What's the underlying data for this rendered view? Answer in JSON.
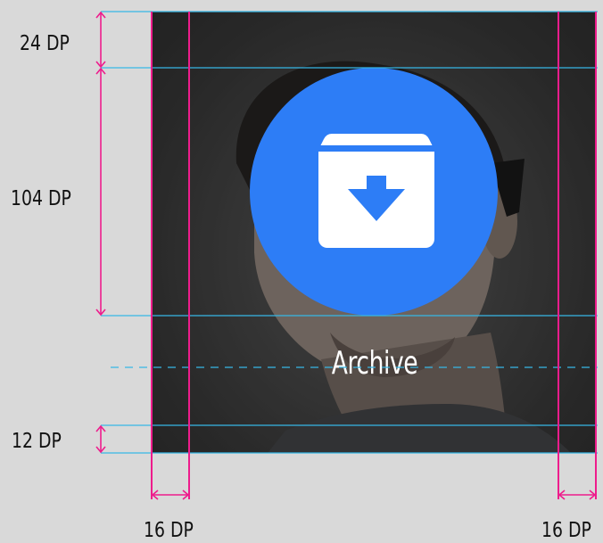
{
  "action": {
    "label": "Archive",
    "icon": "archive-icon",
    "color": "#2d7df6"
  },
  "dimensions": {
    "top_margin": "24 DP",
    "circle_size": "104 DP",
    "bottom_margin": "12 DP",
    "left_padding": "16 DP",
    "right_padding": "16 DP"
  },
  "colors": {
    "keyline": "#ee1c8c",
    "guide": "#37b7e6",
    "background": "#d9d9d9"
  }
}
